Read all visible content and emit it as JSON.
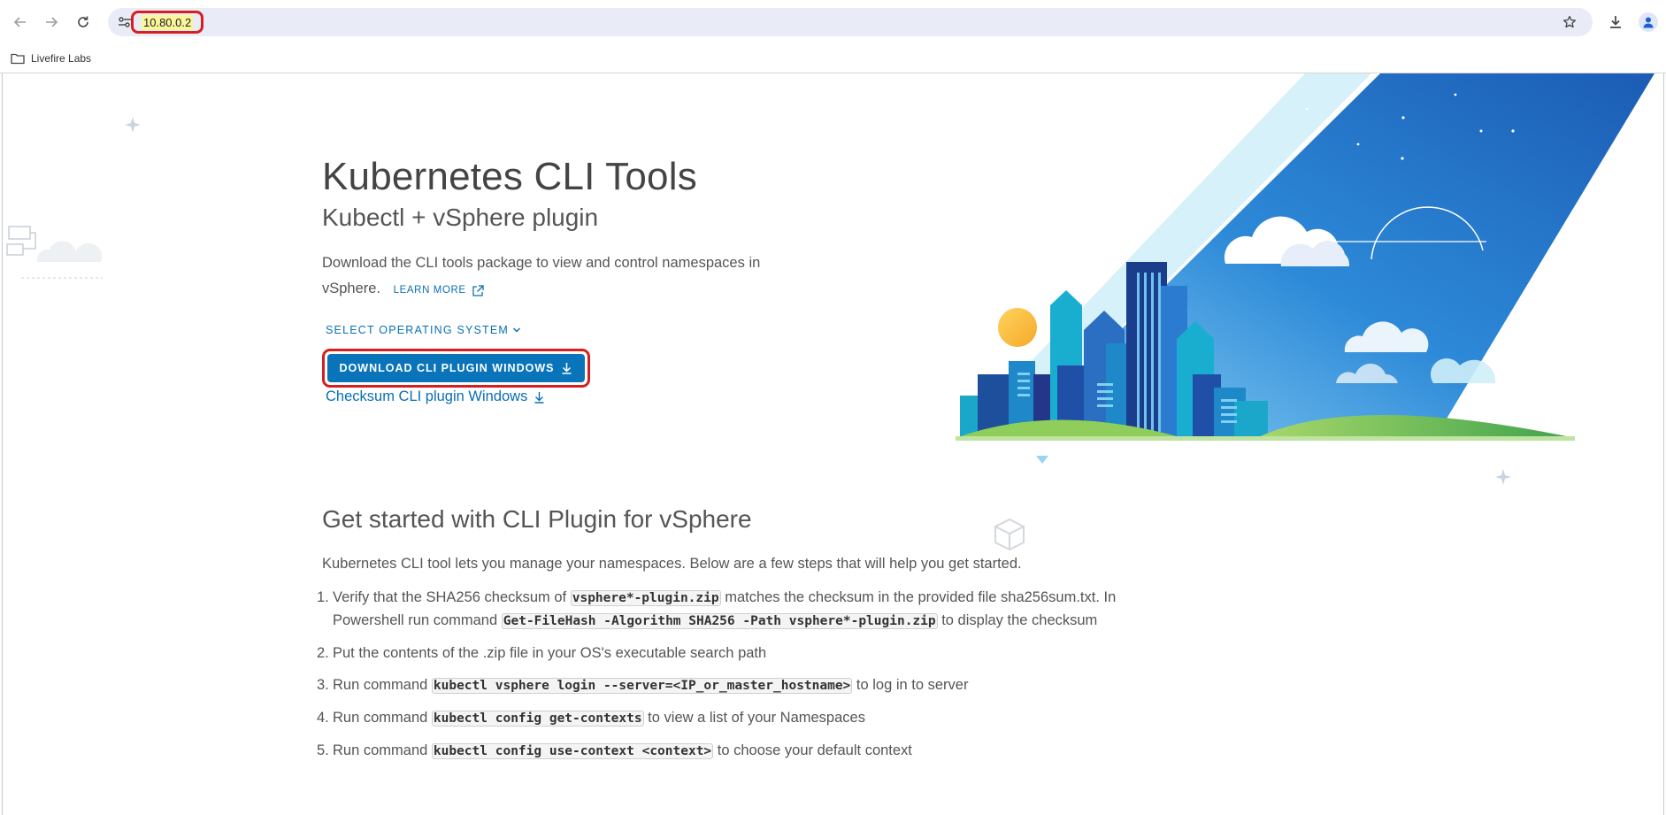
{
  "browser": {
    "url": "10.80.0.2",
    "bookmarks": [
      {
        "label": "Livefire Labs",
        "icon": "folder-icon"
      }
    ]
  },
  "hero": {
    "title": "Kubernetes CLI Tools",
    "subtitle": "Kubectl + vSphere plugin",
    "description": "Download the CLI tools package to view and control namespaces in vSphere.",
    "learn_more": "LEARN MORE",
    "os_select": "SELECT OPERATING SYSTEM",
    "download_button": "DOWNLOAD CLI PLUGIN WINDOWS",
    "checksum_link": "Checksum CLI plugin Windows"
  },
  "getting_started": {
    "title": "Get started with CLI Plugin for vSphere",
    "intro": "Kubernetes CLI tool lets you manage your namespaces. Below are a few steps that will help you get started.",
    "steps": [
      {
        "num": "1.",
        "t1": "Verify that the SHA256 checksum of ",
        "c1": "vsphere*-plugin.zip",
        "t2": " matches the checksum in the provided file sha256sum.txt. In Powershell run command ",
        "c2": "Get-FileHash -Algorithm SHA256 -Path vsphere*-plugin.zip",
        "t3": " to display the checksum"
      },
      {
        "num": "2.",
        "t1": "Put the contents of the .zip file in your OS's executable search path"
      },
      {
        "num": "3.",
        "t1": "Run command ",
        "c1": "kubectl vsphere login --server=<IP_or_master_hostname>",
        "t2": " to log in to server"
      },
      {
        "num": "4.",
        "t1": "Run command ",
        "c1": "kubectl config get-contexts",
        "t2": " to view a list of your Namespaces"
      },
      {
        "num": "5.",
        "t1": "Run command ",
        "c1": "kubectl config use-context <context>",
        "t2": " to choose your default context"
      }
    ]
  },
  "colors": {
    "accent": "#0a74bb",
    "link": "#0a6fb4",
    "highlight_border": "#d61f1f",
    "url_highlight": "#fbf59b"
  }
}
